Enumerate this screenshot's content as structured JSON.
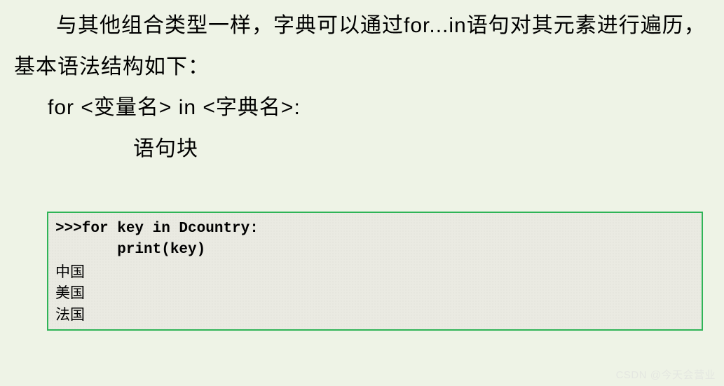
{
  "paragraph": "与其他组合类型一样，字典可以通过for...in语句对其元素进行遍历，基本语法结构如下：",
  "syntax": {
    "line1": "for  <变量名>  in  <字典名>:",
    "line2": "语句块"
  },
  "code": {
    "line1": ">>>for key in Dcountry:",
    "line2": "       print(key)",
    "output1": "中国",
    "output2": "美国",
    "output3": "法国"
  },
  "watermark": "CSDN @今天会营业"
}
